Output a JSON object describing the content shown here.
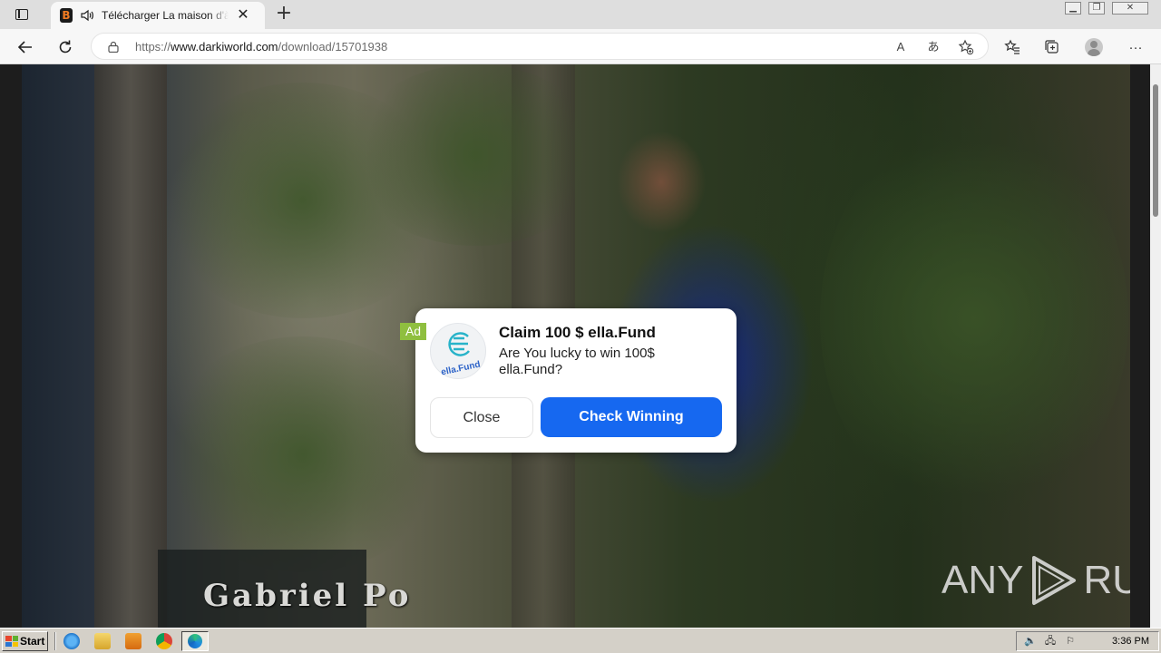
{
  "browser": {
    "tab": {
      "favicon_letter": "B",
      "title": "Télécharger La maison d'à",
      "close_glyph": "✕"
    },
    "new_tab_glyph": "+",
    "window_controls": [
      "▁",
      "❐",
      "✕"
    ],
    "address": {
      "scheme": "https://",
      "host": "www.darkiworld.com",
      "path": "/download/15701938"
    },
    "read_aloud_glyph": "A",
    "translate_glyph": "あ",
    "menu_glyph": "···"
  },
  "video": {
    "caption": "Gabriel Po",
    "watermark_left": "ANY",
    "watermark_right": "RUN"
  },
  "ad": {
    "badge": "Ad",
    "logo_text": "ella.Fund",
    "title": "Claim 100 $ ella.Fund",
    "body": "Are You lucky to win 100$ ella.Fund?",
    "close_label": "Close",
    "cta_label": "Check Winning",
    "cta_color": "#1668f0",
    "badge_color": "#8fbf3f"
  },
  "taskbar": {
    "start_label": "Start",
    "clock": "3:36 PM"
  }
}
